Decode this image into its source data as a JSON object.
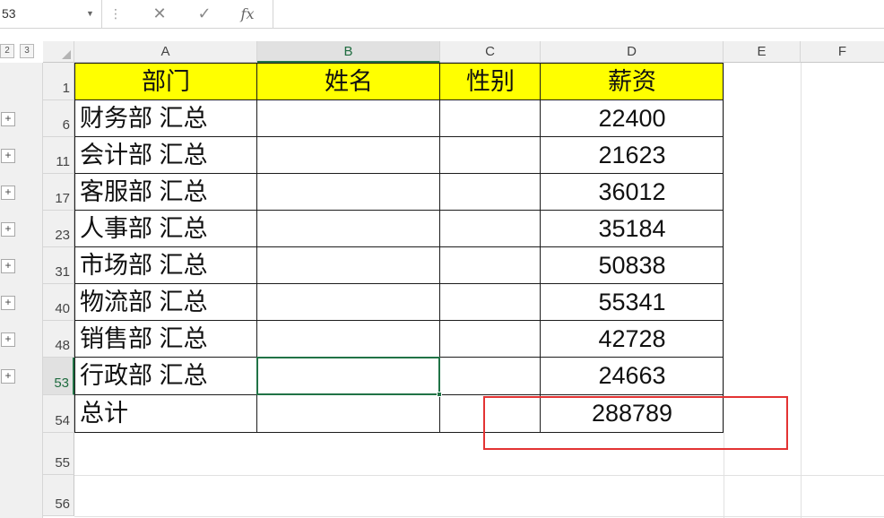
{
  "formula_bar": {
    "name_box": "53",
    "cancel_icon": "✕",
    "enter_icon": "✓",
    "fx_label": "fx",
    "formula": ""
  },
  "outline": {
    "levels": [
      "2",
      "3"
    ],
    "expand_symbol": "+"
  },
  "columns": [
    "A",
    "B",
    "C",
    "D",
    "E",
    "F"
  ],
  "header_row": {
    "row_number": "1",
    "cells": [
      "部门",
      "姓名",
      "性别",
      "薪资"
    ]
  },
  "rows": [
    {
      "row_number": "6",
      "dept": "财务部 汇总",
      "name": "",
      "gender": "",
      "salary": "22400"
    },
    {
      "row_number": "11",
      "dept": "会计部 汇总",
      "name": "",
      "gender": "",
      "salary": "21623"
    },
    {
      "row_number": "17",
      "dept": "客服部 汇总",
      "name": "",
      "gender": "",
      "salary": "36012"
    },
    {
      "row_number": "23",
      "dept": "人事部 汇总",
      "name": "",
      "gender": "",
      "salary": "35184"
    },
    {
      "row_number": "31",
      "dept": "市场部 汇总",
      "name": "",
      "gender": "",
      "salary": "50838"
    },
    {
      "row_number": "40",
      "dept": "物流部 汇总",
      "name": "",
      "gender": "",
      "salary": "55341"
    },
    {
      "row_number": "48",
      "dept": "销售部 汇总",
      "name": "",
      "gender": "",
      "salary": "42728"
    },
    {
      "row_number": "53",
      "dept": "行政部 汇总",
      "name": "",
      "gender": "",
      "salary": "24663"
    }
  ],
  "total_row": {
    "row_number": "54",
    "label": "总计",
    "salary": "288789"
  },
  "empty_rows": [
    "55",
    "56"
  ],
  "colors": {
    "header_fill": "#ffff00",
    "selection": "#217346",
    "highlight": "#e33333"
  },
  "selected_cell": "B53"
}
